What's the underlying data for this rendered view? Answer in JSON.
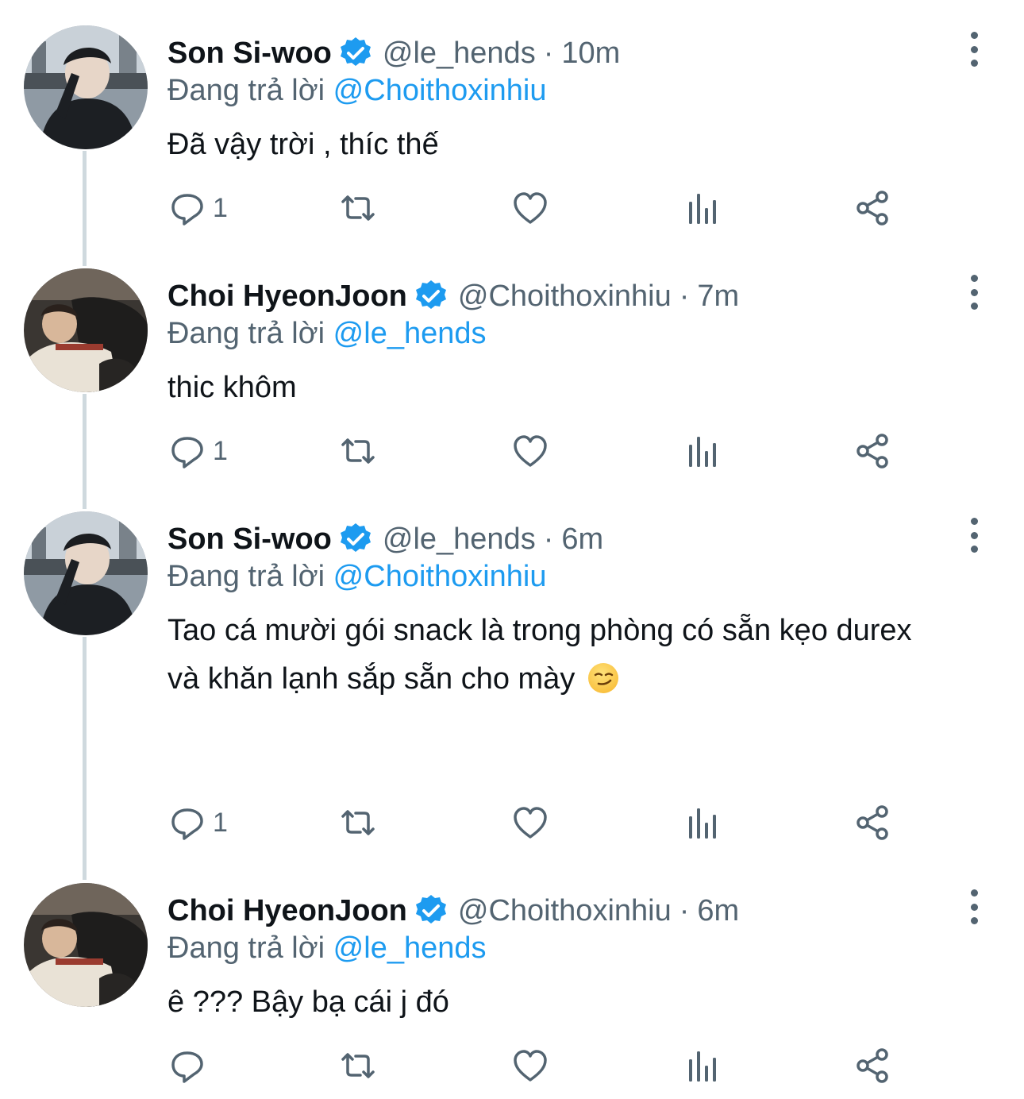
{
  "tweets": [
    {
      "name": "Son Si-woo",
      "handle": "@le_hends",
      "separator": "·",
      "time": "10m",
      "replying_prefix": "Đang trả lời",
      "replying_to": "@Choithoxinhiu",
      "text": "Đã vậy trời , thíc thế",
      "reply_count": "1"
    },
    {
      "name": "Choi HyeonJoon",
      "handle": "@Choithoxinhiu",
      "separator": "·",
      "time": "7m",
      "replying_prefix": "Đang trả lời",
      "replying_to": "@le_hends",
      "text": "thic khôm",
      "reply_count": "1"
    },
    {
      "name": "Son Si-woo",
      "handle": "@le_hends",
      "separator": "·",
      "time": "6m",
      "replying_prefix": "Đang trả lời",
      "replying_to": "@Choithoxinhiu",
      "text_line1": "Tao cá mười gói snack là trong phòng có sẵn kẹo durex",
      "text_line2": "và khăn lạnh sắp sẵn cho mày",
      "emoji": "smirking-face",
      "reply_count": "1"
    },
    {
      "name": "Choi HyeonJoon",
      "handle": "@Choithoxinhiu",
      "separator": "·",
      "time": "6m",
      "replying_prefix": "Đang trả lời",
      "replying_to": "@le_hends",
      "text": "ê ??? Bậy bạ cái j đó",
      "reply_count": ""
    }
  ],
  "icons": {
    "reply": "reply-icon",
    "retweet": "retweet-icon",
    "like": "heart-icon",
    "analytics": "analytics-icon",
    "share": "share-icon",
    "verified": "verified-badge-icon",
    "more": "more-options-icon"
  },
  "colors": {
    "primary_text": "#0f1419",
    "secondary_text": "#536471",
    "link": "#1d9bf0",
    "thread_line": "#cfd9de"
  }
}
